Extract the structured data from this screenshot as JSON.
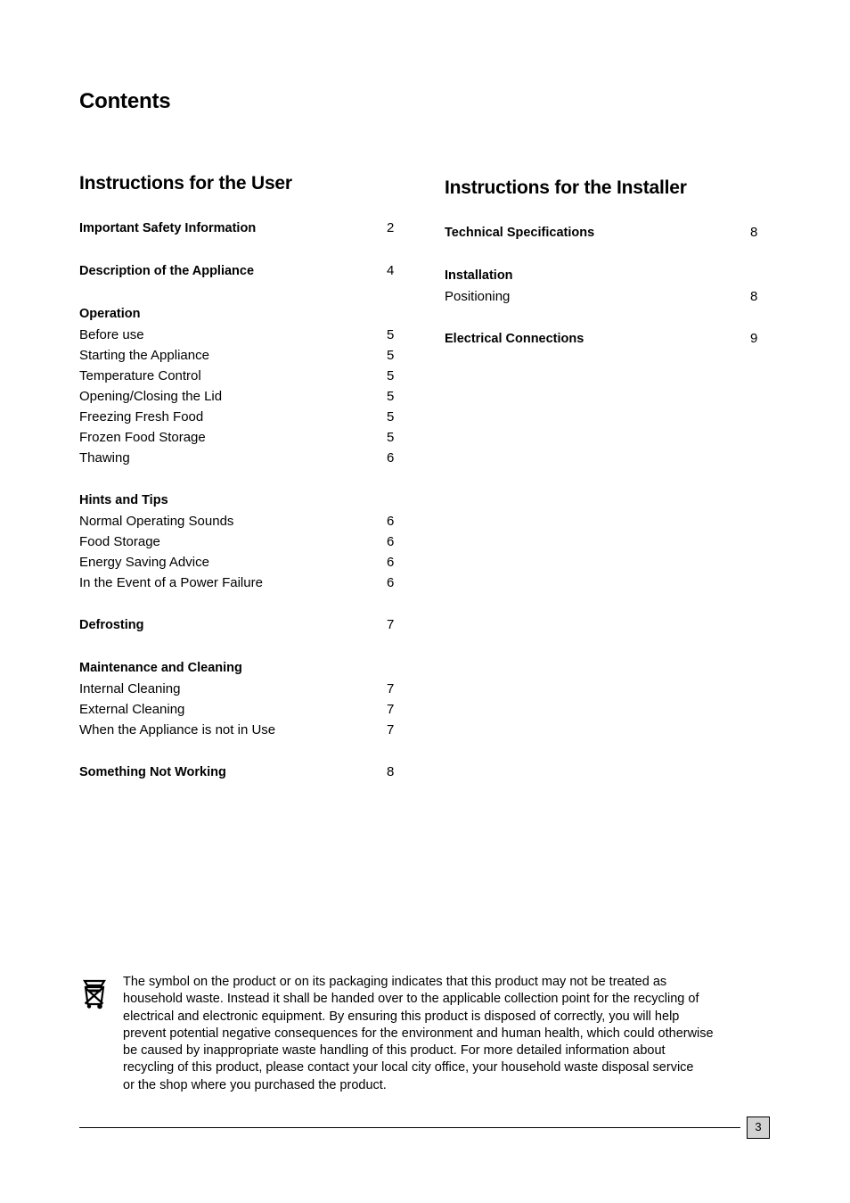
{
  "document": {
    "title": "Contents",
    "page_number": "3"
  },
  "columns": [
    {
      "heading": "Instructions for the User",
      "entries": [
        {
          "label": "Important Safety Information",
          "page": "2",
          "bold": true,
          "gap_before": "lg"
        },
        {
          "label": "Description of the Appliance",
          "page": "4",
          "bold": true,
          "gap_before": "md"
        },
        {
          "label": "Operation",
          "page": "",
          "bold": true,
          "gap_before": "md"
        },
        {
          "label": "Before use",
          "page": "5",
          "bold": false,
          "gap_before": "none"
        },
        {
          "label": "Starting the Appliance",
          "page": "5",
          "bold": false,
          "gap_before": "none"
        },
        {
          "label": "Temperature Control",
          "page": "5",
          "bold": false,
          "gap_before": "none"
        },
        {
          "label": "Opening/Closing the Lid",
          "page": "5",
          "bold": false,
          "gap_before": "none"
        },
        {
          "label": "Freezing Fresh Food",
          "page": "5",
          "bold": false,
          "gap_before": "none"
        },
        {
          "label": "Frozen Food Storage",
          "page": "5",
          "bold": false,
          "gap_before": "none"
        },
        {
          "label": "Thawing",
          "page": "6",
          "bold": false,
          "gap_before": "none"
        },
        {
          "label": "Hints and Tips",
          "page": "",
          "bold": true,
          "gap_before": "md"
        },
        {
          "label": "Normal Operating Sounds",
          "page": "6",
          "bold": false,
          "gap_before": "none"
        },
        {
          "label": "Food Storage",
          "page": "6",
          "bold": false,
          "gap_before": "none"
        },
        {
          "label": "Energy Saving Advice",
          "page": "6",
          "bold": false,
          "gap_before": "none"
        },
        {
          "label": "In the Event of a Power Failure",
          "page": "6",
          "bold": false,
          "gap_before": "none"
        },
        {
          "label": "Defrosting",
          "page": "7",
          "bold": true,
          "gap_before": "md"
        },
        {
          "label": "Maintenance and Cleaning",
          "page": "",
          "bold": true,
          "gap_before": "md"
        },
        {
          "label": "Internal Cleaning",
          "page": "7",
          "bold": false,
          "gap_before": "none"
        },
        {
          "label": "External Cleaning",
          "page": "7",
          "bold": false,
          "gap_before": "none"
        },
        {
          "label": "When the Appliance is not in Use",
          "page": "7",
          "bold": false,
          "gap_before": "none"
        },
        {
          "label": "Something Not Working",
          "page": "8",
          "bold": true,
          "gap_before": "md"
        }
      ]
    },
    {
      "heading": "Instructions for the Installer",
      "entries": [
        {
          "label": "Technical Specifications",
          "page": "8",
          "bold": true,
          "gap_before": "lg"
        },
        {
          "label": "Installation",
          "page": "",
          "bold": true,
          "gap_before": "md"
        },
        {
          "label": "Positioning",
          "page": "8",
          "bold": false,
          "gap_before": "none"
        },
        {
          "label": "Electrical Connections",
          "page": "9",
          "bold": true,
          "gap_before": "md"
        }
      ]
    }
  ],
  "weee_note": {
    "icon": "crossed-out-wheelie-bin-icon",
    "lines": [
      "The symbol on the product or on its packaging indicates that this product may not be treated as",
      "household waste. Instead it shall be handed over to the applicable collection point for the recycling of",
      "electrical and electronic equipment. By ensuring this product is disposed of correctly, you will help",
      "prevent potential negative consequences for the environment and human health, which could otherwise",
      "be caused by inappropriate waste handling of this product. For more detailed information about",
      "recycling of this product, please contact your local city office, your household waste disposal service",
      "or the shop where you purchased the product."
    ]
  },
  "colors": {
    "text": "#000000",
    "page_box_fill": "#d2d2d2",
    "page_box_border": "#000000",
    "background": "#ffffff"
  }
}
